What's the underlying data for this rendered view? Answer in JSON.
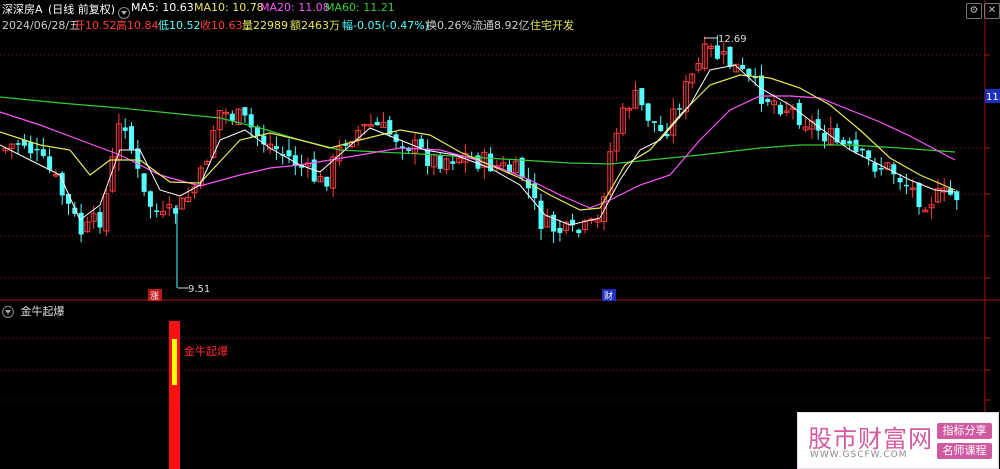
{
  "header": {
    "stock_name": "深深房A",
    "mode": "(日线 前复权)",
    "ma5_label": "MA5: 10.63",
    "ma10_label": "MA10: 10.78",
    "ma20_label": "MA20: 11.08",
    "ma60_label": "MA60: 11.21",
    "date": "2024/06/28/五",
    "open": "开10.52",
    "high": "高10.84",
    "low": "低10.52",
    "close": "收10.63",
    "volume": "量22989",
    "amount": "额2463万",
    "change": "幅-0.05(-0.47%)",
    "turnover": "换0.26%",
    "float": "流通8.92亿",
    "sector": "住宅开发"
  },
  "colors": {
    "up": "#ff3b3b",
    "down": "#54ffff",
    "ma5": "#ffffff",
    "ma10": "#e8e85a",
    "ma20": "#ff55ff",
    "ma60": "#33cc33",
    "grid": "#7a1010"
  },
  "main_chart": {
    "high_mark": "12.69",
    "low_mark": "9.51",
    "price_tag": "11.",
    "event_left": "涨",
    "event_right": "财"
  },
  "indicator": {
    "title": "金牛起爆",
    "signal_label": "金牛起爆"
  },
  "top_icons": {
    "settings_glyph": "⚙",
    "close_glyph": "✕"
  },
  "watermark": {
    "main": "股市财富网",
    "url": "WWW.GSCFW.COM",
    "tag1": "指标分享",
    "tag2": "名师课程"
  }
}
